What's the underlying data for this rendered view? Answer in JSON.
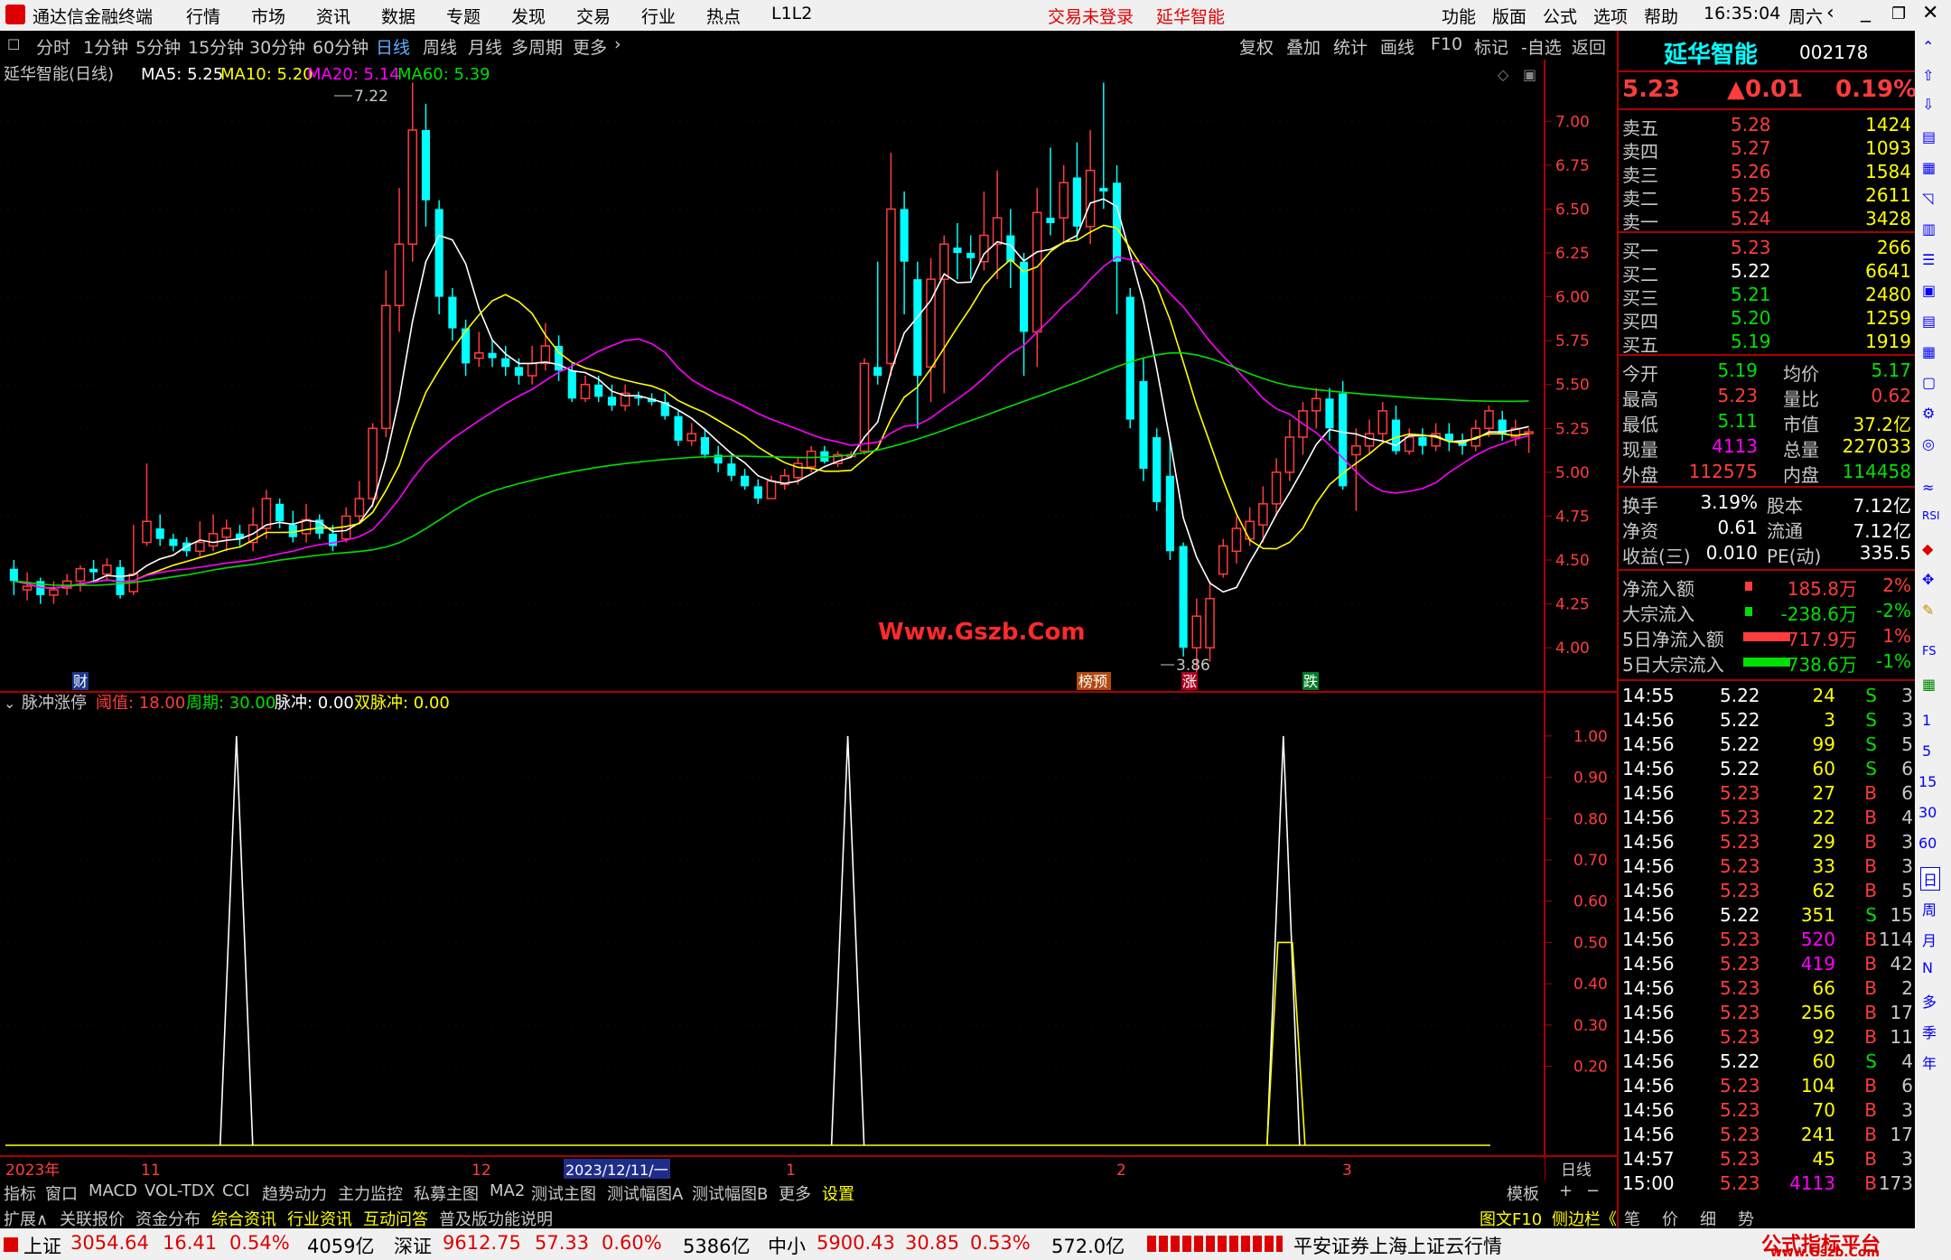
{
  "app": {
    "title": "通达信金融终端",
    "menu": [
      "行情",
      "市场",
      "资讯",
      "数据",
      "专题",
      "发现",
      "交易",
      "行业",
      "热点",
      "L1L2"
    ],
    "login": "交易未登录",
    "stock_title": "延华智能",
    "right_menu": [
      "功能",
      "版面",
      "公式",
      "选项",
      "帮助"
    ],
    "time": "16:35:04",
    "weekday": "周六"
  },
  "period": {
    "items": [
      "分时",
      "1分钟",
      "5分钟",
      "15分钟",
      "30分钟",
      "60分钟",
      "日线",
      "周线",
      "月线",
      "多周期",
      "更多"
    ],
    "active": "日线",
    "tools": [
      "复权",
      "叠加",
      "统计",
      "画线",
      "F10",
      "标记",
      "-自选",
      "返回"
    ]
  },
  "main": {
    "title": "延华智能(日线)",
    "ma5": "MA5: 5.25",
    "ma10": "MA10: 5.20",
    "ma20": "MA20: 5.14",
    "ma60": "MA60: 5.39",
    "high_label": "7.22",
    "low_label": "3.86",
    "watermark": "Www.Gszb.Com",
    "marker_cai": "财",
    "marker_bang": "榜预",
    "marker_zhang": "涨",
    "marker_die": "跌",
    "y_ticks": [
      "7.00",
      "6.75",
      "6.50",
      "6.25",
      "6.00",
      "5.75",
      "5.50",
      "5.25",
      "5.00",
      "4.75",
      "4.50",
      "4.25",
      "4.00"
    ]
  },
  "indicator": {
    "name": "脉冲涨停",
    "threshold": "阈值: 18.00",
    "cycle": "周期: 30.00",
    "pulse": "脉冲: 0.00",
    "dual": "双脉冲: 0.00",
    "y_ticks": [
      "1.00",
      "0.90",
      "0.80",
      "0.70",
      "0.60",
      "0.50",
      "0.40",
      "0.30",
      "0.20"
    ]
  },
  "xaxis": {
    "labels": [
      "2023年",
      "11",
      "12",
      "2023/12/11/一",
      "1",
      "2",
      "3"
    ],
    "period": "日线"
  },
  "quote": {
    "name": "延华智能",
    "code": "002178",
    "price": "5.23",
    "change": "▲0.01",
    "pct": "0.19%",
    "asks": [
      {
        "label": "卖五",
        "price": "5.28",
        "vol": "1424"
      },
      {
        "label": "卖四",
        "price": "5.27",
        "vol": "1093"
      },
      {
        "label": "卖三",
        "price": "5.26",
        "vol": "1584"
      },
      {
        "label": "卖二",
        "price": "5.25",
        "vol": "2611"
      },
      {
        "label": "卖一",
        "price": "5.24",
        "vol": "3428"
      }
    ],
    "bids": [
      {
        "label": "买一",
        "price": "5.23",
        "vol": "266"
      },
      {
        "label": "买二",
        "price": "5.22",
        "vol": "6641"
      },
      {
        "label": "买三",
        "price": "5.21",
        "vol": "2480"
      },
      {
        "label": "买四",
        "price": "5.20",
        "vol": "1259"
      },
      {
        "label": "买五",
        "price": "5.19",
        "vol": "1919"
      }
    ],
    "stats": [
      [
        "今开",
        "5.19",
        "均价",
        "5.17"
      ],
      [
        "最高",
        "5.23",
        "量比",
        "0.62"
      ],
      [
        "最低",
        "5.11",
        "市值",
        "37.2亿"
      ],
      [
        "现量",
        "4113",
        "总量",
        "227033"
      ],
      [
        "外盘",
        "112575",
        "内盘",
        "114458"
      ]
    ],
    "stats2": [
      [
        "换手",
        "3.19%",
        "股本",
        "7.12亿"
      ],
      [
        "净资",
        "0.61",
        "流通",
        "7.12亿"
      ],
      [
        "收益(三)",
        "0.010",
        "PE(动)",
        "335.5"
      ]
    ],
    "flows": [
      {
        "label": "净流入额",
        "val": "185.8万",
        "pct": "2%",
        "pos": true
      },
      {
        "label": "大宗流入",
        "val": "-238.6万",
        "pct": "-2%",
        "pos": false
      },
      {
        "label": "5日净流入额",
        "val": "717.9万",
        "pct": "1%",
        "pos": true
      },
      {
        "label": "5日大宗流入",
        "val": "-738.6万",
        "pct": "-1%",
        "pos": false
      }
    ],
    "ticks": [
      [
        "14:55",
        "5.22",
        "24",
        "S",
        "3"
      ],
      [
        "14:56",
        "5.22",
        "3",
        "S",
        "3"
      ],
      [
        "14:56",
        "5.22",
        "99",
        "S",
        "5"
      ],
      [
        "14:56",
        "5.22",
        "60",
        "S",
        "6"
      ],
      [
        "14:56",
        "5.23",
        "27",
        "B",
        "6"
      ],
      [
        "14:56",
        "5.23",
        "22",
        "B",
        "4"
      ],
      [
        "14:56",
        "5.23",
        "29",
        "B",
        "3"
      ],
      [
        "14:56",
        "5.23",
        "33",
        "B",
        "3"
      ],
      [
        "14:56",
        "5.23",
        "62",
        "B",
        "5"
      ],
      [
        "14:56",
        "5.22",
        "351",
        "S",
        "15"
      ],
      [
        "14:56",
        "5.23",
        "520",
        "B",
        "114"
      ],
      [
        "14:56",
        "5.23",
        "419",
        "B",
        "42"
      ],
      [
        "14:56",
        "5.23",
        "66",
        "B",
        "2"
      ],
      [
        "14:56",
        "5.23",
        "256",
        "B",
        "17"
      ],
      [
        "14:56",
        "5.23",
        "92",
        "B",
        "11"
      ],
      [
        "14:56",
        "5.22",
        "60",
        "S",
        "4"
      ],
      [
        "14:56",
        "5.23",
        "104",
        "B",
        "6"
      ],
      [
        "14:56",
        "5.23",
        "70",
        "B",
        "3"
      ],
      [
        "14:56",
        "5.23",
        "241",
        "B",
        "17"
      ],
      [
        "14:57",
        "5.23",
        "45",
        "B",
        "3"
      ],
      [
        "15:00",
        "5.23",
        "4113",
        "B",
        "173"
      ]
    ]
  },
  "side": [
    "日",
    "周",
    "月",
    "N",
    "多",
    "季",
    "年"
  ],
  "side_nums": [
    "1",
    "5",
    "15",
    "30",
    "60"
  ],
  "tabs1": [
    "指标",
    "窗口",
    "MACD",
    "VOL-TDX",
    "CCI",
    "趋势动力",
    "主力监控",
    "私募主图",
    "MA2",
    "测试主图",
    "测试幅图A",
    "测试幅图B",
    "更多",
    "设置"
  ],
  "tabs1_right": [
    "模板",
    "+",
    "−"
  ],
  "tabs2": [
    "扩展∧",
    "关联报价",
    "资金分布",
    "综合资讯",
    "行业资讯",
    "互动问答",
    "普及版功能说明"
  ],
  "tabs2_right": [
    "图文F10",
    "侧边栏《",
    "笔",
    "价",
    "细",
    "势"
  ],
  "status": {
    "sh_label": "上证",
    "sh": "3054.64",
    "sh_chg": "16.41",
    "sh_pct": "0.54%",
    "sh_amt": "4059亿",
    "sz_label": "深证",
    "sz": "9612.75",
    "sz_chg": "57.33",
    "sz_pct": "0.60%",
    "sz_amt": "5386亿",
    "zx_label": "中小",
    "zx": "5900.43",
    "zx_chg": "30.85",
    "zx_pct": "0.53%",
    "zx_amt": "572.0亿",
    "broker": "平安证券上海上证云行情",
    "brand": "公式指标平台",
    "brand_url": "www.Gszb.Com"
  },
  "colors": {
    "up": "#ff3c3c",
    "down": "#00ffff",
    "ma5": "#ffffff",
    "ma10": "#ffff00",
    "ma20": "#ff00ff",
    "ma60": "#00e000"
  },
  "chart_data": {
    "type": "candlestick",
    "title": "延华智能(日线)",
    "ylim": [
      3.8,
      7.3
    ],
    "candles": [
      [
        4.45,
        4.38,
        4.5,
        4.3
      ],
      [
        4.33,
        4.35,
        4.43,
        4.27
      ],
      [
        4.38,
        4.3,
        4.4,
        4.25
      ],
      [
        4.3,
        4.33,
        4.38,
        4.25
      ],
      [
        4.34,
        4.38,
        4.42,
        4.3
      ],
      [
        4.38,
        4.45,
        4.47,
        4.32
      ],
      [
        4.45,
        4.43,
        4.5,
        4.38
      ],
      [
        4.42,
        4.47,
        4.51,
        4.38
      ],
      [
        4.46,
        4.3,
        4.5,
        4.28
      ],
      [
        4.32,
        4.42,
        4.7,
        4.3
      ],
      [
        4.6,
        4.72,
        5.05,
        4.58
      ],
      [
        4.68,
        4.62,
        4.76,
        4.58
      ],
      [
        4.62,
        4.58,
        4.65,
        4.55
      ],
      [
        4.6,
        4.55,
        4.63,
        4.52
      ],
      [
        4.55,
        4.6,
        4.72,
        4.52
      ],
      [
        4.58,
        4.65,
        4.76,
        4.55
      ],
      [
        4.63,
        4.68,
        4.73,
        4.55
      ],
      [
        4.65,
        4.62,
        4.7,
        4.58
      ],
      [
        4.6,
        4.7,
        4.8,
        4.55
      ],
      [
        4.68,
        4.85,
        4.9,
        4.62
      ],
      [
        4.82,
        4.72,
        4.85,
        4.68
      ],
      [
        4.7,
        4.63,
        4.78,
        4.6
      ],
      [
        4.65,
        4.73,
        4.82,
        4.6
      ],
      [
        4.73,
        4.65,
        4.76,
        4.62
      ],
      [
        4.65,
        4.58,
        4.7,
        4.55
      ],
      [
        4.62,
        4.75,
        4.8,
        4.6
      ],
      [
        4.75,
        4.85,
        4.95,
        4.72
      ],
      [
        4.85,
        5.25,
        5.28,
        4.8
      ],
      [
        5.25,
        5.95,
        6.15,
        5.2
      ],
      [
        5.95,
        6.3,
        6.62,
        5.8
      ],
      [
        6.3,
        6.95,
        7.22,
        6.2
      ],
      [
        6.95,
        6.55,
        7.1,
        6.4
      ],
      [
        6.5,
        6.0,
        6.55,
        5.9
      ],
      [
        6.0,
        5.82,
        6.05,
        5.75
      ],
      [
        5.82,
        5.62,
        5.87,
        5.55
      ],
      [
        5.65,
        5.68,
        5.8,
        5.6
      ],
      [
        5.68,
        5.65,
        5.75,
        5.6
      ],
      [
        5.65,
        5.6,
        5.72,
        5.55
      ],
      [
        5.6,
        5.55,
        5.65,
        5.5
      ],
      [
        5.55,
        5.62,
        5.72,
        5.5
      ],
      [
        5.62,
        5.72,
        5.85,
        5.58
      ],
      [
        5.72,
        5.58,
        5.78,
        5.52
      ],
      [
        5.58,
        5.42,
        5.62,
        5.4
      ],
      [
        5.42,
        5.5,
        5.55,
        5.4
      ],
      [
        5.5,
        5.43,
        5.55,
        5.4
      ],
      [
        5.43,
        5.38,
        5.5,
        5.35
      ],
      [
        5.38,
        5.45,
        5.5,
        5.35
      ],
      [
        5.43,
        5.42,
        5.46,
        5.38
      ],
      [
        5.42,
        5.4,
        5.45,
        5.38
      ],
      [
        5.4,
        5.32,
        5.45,
        5.3
      ],
      [
        5.32,
        5.18,
        5.35,
        5.15
      ],
      [
        5.18,
        5.22,
        5.28,
        5.15
      ],
      [
        5.2,
        5.1,
        5.25,
        5.08
      ],
      [
        5.1,
        5.05,
        5.15,
        5.0
      ],
      [
        5.05,
        4.98,
        5.1,
        4.95
      ],
      [
        4.98,
        4.92,
        5.02,
        4.9
      ],
      [
        4.92,
        4.85,
        4.96,
        4.82
      ],
      [
        4.85,
        4.95,
        4.98,
        4.85
      ],
      [
        4.93,
        4.98,
        5.02,
        4.9
      ],
      [
        4.97,
        5.05,
        5.08,
        4.93
      ],
      [
        5.03,
        5.12,
        5.15,
        5.0
      ],
      [
        5.12,
        5.06,
        5.15,
        5.05
      ],
      [
        5.05,
        5.1,
        5.12,
        5.03
      ],
      [
        5.1,
        5.1,
        5.12,
        5.08
      ],
      [
        5.12,
        5.62,
        5.65,
        5.1
      ],
      [
        5.6,
        5.55,
        6.2,
        5.5
      ],
      [
        5.62,
        6.5,
        6.82,
        5.55
      ],
      [
        6.5,
        6.2,
        6.6,
        5.9
      ],
      [
        6.1,
        5.55,
        6.2,
        5.25
      ],
      [
        5.6,
        6.1,
        6.22,
        5.4
      ],
      [
        6.1,
        6.3,
        6.35,
        5.45
      ],
      [
        6.28,
        6.25,
        6.42,
        6.1
      ],
      [
        6.25,
        6.22,
        6.35,
        6.1
      ],
      [
        6.2,
        6.35,
        6.6,
        6.15
      ],
      [
        6.3,
        6.45,
        6.72,
        6.1
      ],
      [
        6.35,
        6.2,
        6.5,
        6.05
      ],
      [
        6.2,
        5.8,
        6.25,
        5.55
      ],
      [
        5.8,
        6.48,
        6.62,
        5.6
      ],
      [
        6.45,
        6.42,
        6.85,
        6.35
      ],
      [
        6.45,
        6.65,
        6.75,
        6.3
      ],
      [
        6.68,
        6.4,
        6.88,
        6.32
      ],
      [
        6.4,
        6.72,
        6.95,
        6.3
      ],
      [
        6.62,
        6.6,
        7.22,
        6.5
      ],
      [
        6.65,
        6.2,
        6.75,
        5.9
      ],
      [
        6.0,
        5.3,
        6.05,
        5.25
      ],
      [
        5.52,
        5.02,
        5.65,
        4.95
      ],
      [
        5.2,
        4.83,
        5.25,
        4.78
      ],
      [
        4.98,
        4.55,
        5.18,
        4.5
      ],
      [
        4.58,
        4.0,
        4.6,
        3.95
      ],
      [
        4.0,
        4.18,
        4.28,
        3.86
      ],
      [
        4.0,
        4.28,
        4.38,
        3.92
      ],
      [
        4.42,
        4.58,
        4.62,
        4.4
      ],
      [
        4.55,
        4.68,
        4.75,
        4.48
      ],
      [
        4.62,
        4.72,
        4.8,
        4.58
      ],
      [
        4.7,
        4.82,
        4.92,
        4.6
      ],
      [
        4.82,
        5.0,
        5.08,
        4.75
      ],
      [
        5.0,
        5.2,
        5.3,
        4.95
      ],
      [
        5.2,
        5.35,
        5.4,
        5.1
      ],
      [
        5.35,
        5.42,
        5.48,
        5.25
      ],
      [
        5.42,
        5.25,
        5.48,
        5.18
      ],
      [
        5.45,
        4.92,
        5.52,
        4.9
      ],
      [
        5.1,
        5.15,
        5.25,
        4.78
      ],
      [
        5.15,
        5.22,
        5.3,
        5.1
      ],
      [
        5.22,
        5.35,
        5.4,
        5.18
      ],
      [
        5.3,
        5.12,
        5.38,
        5.1
      ],
      [
        5.12,
        5.2,
        5.25,
        5.1
      ],
      [
        5.2,
        5.15,
        5.25,
        5.1
      ],
      [
        5.15,
        5.22,
        5.28,
        5.12
      ],
      [
        5.22,
        5.18,
        5.28,
        5.12
      ],
      [
        5.18,
        5.15,
        5.22,
        5.1
      ],
      [
        5.15,
        5.25,
        5.3,
        5.12
      ],
      [
        5.25,
        5.35,
        5.38,
        5.2
      ],
      [
        5.3,
        5.22,
        5.35,
        5.18
      ],
      [
        5.2,
        5.25,
        5.3,
        5.15
      ],
      [
        5.22,
        5.23,
        5.25,
        5.11
      ]
    ],
    "pulse": {
      "ylim": [
        0,
        1.05
      ],
      "spikes": [
        {
          "x": 0.15,
          "y": 1.0,
          "color": "#ffffff"
        },
        {
          "x": 0.55,
          "y": 1.0,
          "color": "#ffffff"
        },
        {
          "x": 0.835,
          "y": 1.0,
          "color": "#ffffff"
        },
        {
          "x": 0.835,
          "y": 0.5,
          "color": "#ffff00"
        }
      ]
    }
  }
}
